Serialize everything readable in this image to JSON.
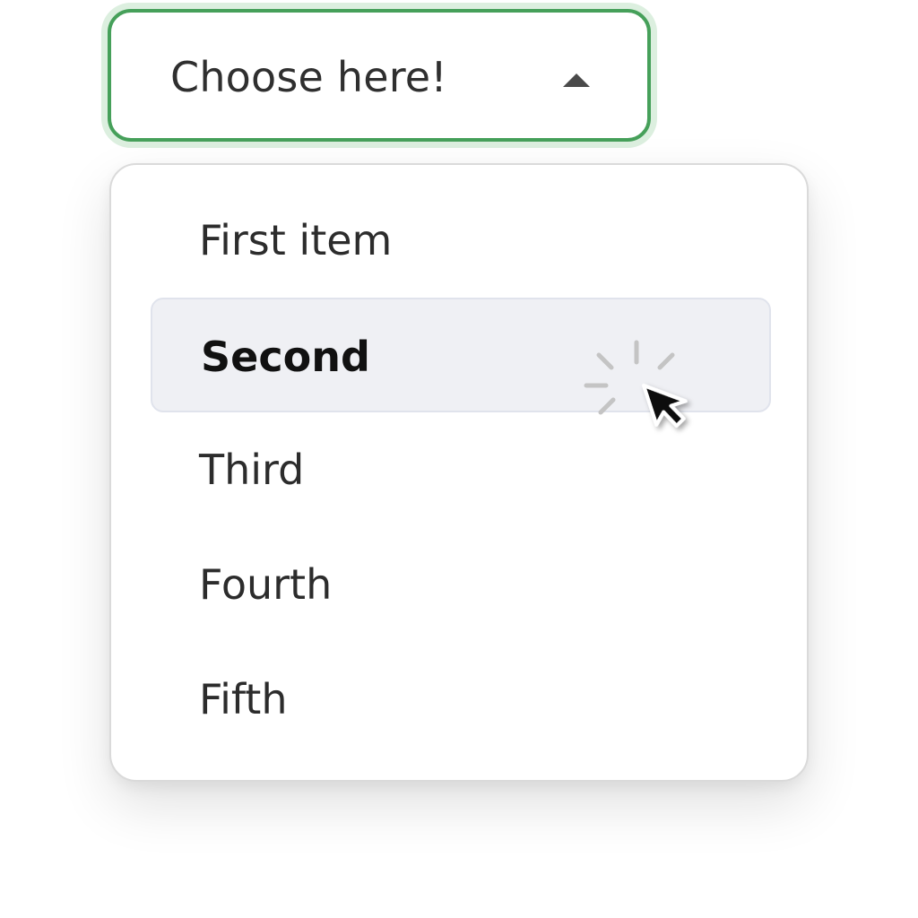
{
  "dropdown": {
    "trigger_label": "Choose here!",
    "caret_icon": "caret-up-icon",
    "accent_color": "#46a05a",
    "expanded": true,
    "options": [
      {
        "label": "First item"
      },
      {
        "label": "Second"
      },
      {
        "label": "Third"
      },
      {
        "label": "Fourth"
      },
      {
        "label": "Fifth"
      }
    ],
    "hovered_index": 1
  },
  "cursor": {
    "icon": "pointer-cursor-icon",
    "effect": "click-burst-icon"
  }
}
